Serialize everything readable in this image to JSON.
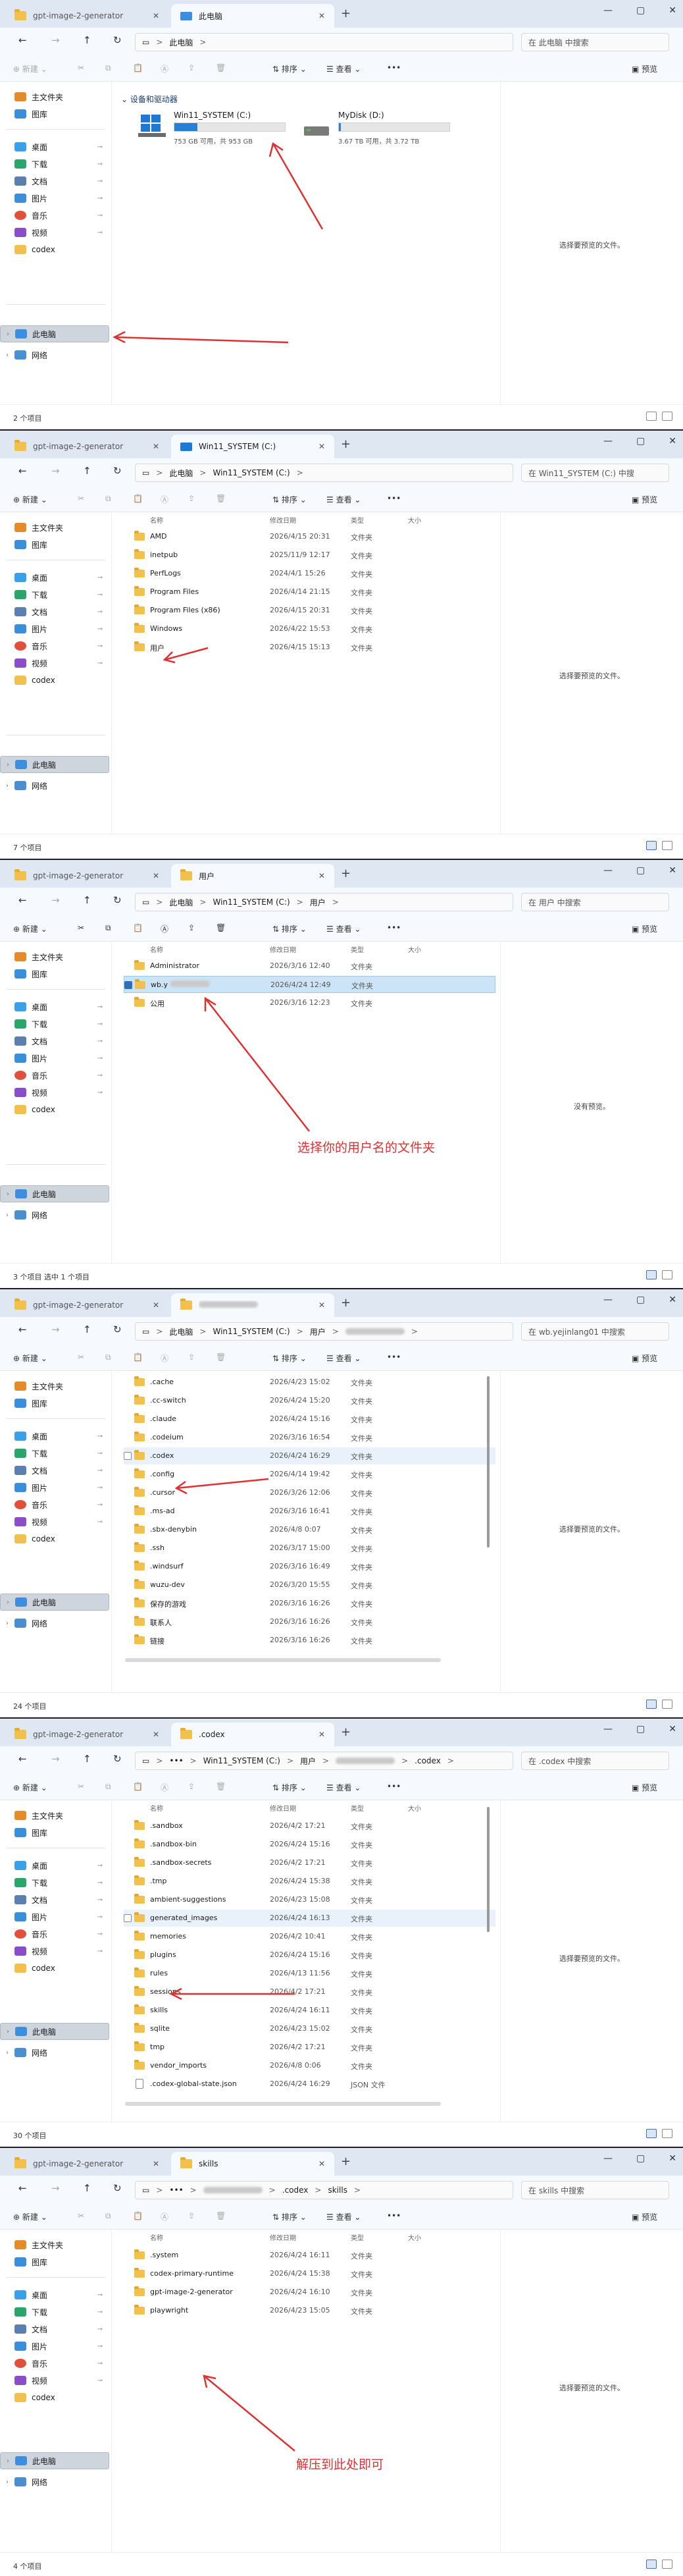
{
  "common": {
    "tab_first": "gpt-image-2-generator",
    "new_tab": "+",
    "win_min": "—",
    "win_max": "▢",
    "win_close": "✕",
    "tab_close": "✕",
    "back": "←",
    "forward": "→",
    "up": "↑",
    "refresh": "↻",
    "new_label": "新建",
    "new_arrow": "⌄",
    "sort_label": "排序",
    "view_label": "查看",
    "more": "•••",
    "details_label": "预览",
    "col_name": "名称",
    "col_date": "修改日期",
    "col_type": "类型",
    "col_size": "大小",
    "crumb_sep": ">",
    "ellipsis": "•••",
    "sidebar": {
      "home": "主文件夹",
      "gallery": "图库",
      "desktop": "桌面",
      "downloads": "下载",
      "documents": "文档",
      "pictures": "图片",
      "music": "音乐",
      "videos": "视频",
      "codex": "codex",
      "thispc": "此电脑",
      "network": "网络",
      "pin": "⊸",
      "chevron": "›"
    },
    "colors": {
      "accent": "#2680d8",
      "arrow": "#e03030",
      "folder": "#f2c04c"
    }
  },
  "screens": [
    {
      "active_tab": "此电脑",
      "crumbs": [
        "此电脑"
      ],
      "search": "在 此电脑 中搜索",
      "group_header": "设备和驱动器",
      "drives": [
        {
          "name": "Win11_SYSTEM (C:)",
          "size": "753 GB 可用，共 953 GB",
          "used": 0.21
        },
        {
          "name": "MyDisk (D:)",
          "size": "3.67 TB 可用，共 3.72 TB",
          "used": 0.02
        }
      ],
      "preview": "选择要预览的文件。",
      "status": "2 个项目",
      "rows": []
    },
    {
      "active_tab": "Win11_SYSTEM (C:)",
      "crumbs": [
        "此电脑",
        "Win11_SYSTEM (C:)"
      ],
      "search": "在 Win11_SYSTEM (C:) 中搜",
      "preview": "选择要预览的文件。",
      "status": "7 个项目",
      "rows": [
        {
          "name": "AMD",
          "date": "2026/4/15 20:31",
          "type": "文件夹"
        },
        {
          "name": "inetpub",
          "date": "2025/11/9 12:17",
          "type": "文件夹"
        },
        {
          "name": "PerfLogs",
          "date": "2024/4/1 15:26",
          "type": "文件夹"
        },
        {
          "name": "Program Files",
          "date": "2026/4/14 21:15",
          "type": "文件夹"
        },
        {
          "name": "Program Files (x86)",
          "date": "2026/4/15 20:31",
          "type": "文件夹"
        },
        {
          "name": "Windows",
          "date": "2026/4/22 15:53",
          "type": "文件夹"
        },
        {
          "name": "用户",
          "date": "2026/4/15 15:13",
          "type": "文件夹"
        }
      ]
    },
    {
      "active_tab": "用户",
      "crumbs": [
        "此电脑",
        "Win11_SYSTEM (C:)",
        "用户"
      ],
      "search": "在 用户 中搜索",
      "preview": "没有预览。",
      "status": "3 个项目    选中 1 个项目",
      "annotation": "选择你的用户名的文件夹",
      "rows": [
        {
          "name": "Administrator",
          "date": "2026/3/16 12:40",
          "type": "文件夹"
        },
        {
          "name": "wb.y",
          "date": "2026/4/24 12:49",
          "type": "文件夹",
          "selected": true
        },
        {
          "name": "公用",
          "date": "2026/3/16 12:23",
          "type": "文件夹"
        }
      ]
    },
    {
      "active_tab": "",
      "crumbs": [
        "此电脑",
        "Win11_SYSTEM (C:)",
        "用户",
        ""
      ],
      "search": "在 wb.yejinlang01 中搜索",
      "preview": "选择要预览的文件。",
      "status": "24 个项目",
      "rows": [
        {
          "name": ".cache",
          "date": "2026/4/23 15:02",
          "type": "文件夹"
        },
        {
          "name": ".cc-switch",
          "date": "2026/4/24 15:20",
          "type": "文件夹"
        },
        {
          "name": ".claude",
          "date": "2026/4/24 15:16",
          "type": "文件夹"
        },
        {
          "name": ".codeium",
          "date": "2026/3/16 16:54",
          "type": "文件夹"
        },
        {
          "name": ".codex",
          "date": "2026/4/24 16:29",
          "type": "文件夹",
          "hover": true
        },
        {
          "name": ".config",
          "date": "2026/4/14 19:42",
          "type": "文件夹"
        },
        {
          "name": ".cursor",
          "date": "2026/3/26 12:06",
          "type": "文件夹"
        },
        {
          "name": ".ms-ad",
          "date": "2026/3/16 16:41",
          "type": "文件夹"
        },
        {
          "name": ".sbx-denybin",
          "date": "2026/4/8 0:07",
          "type": "文件夹"
        },
        {
          "name": ".ssh",
          "date": "2026/3/17 15:00",
          "type": "文件夹"
        },
        {
          "name": ".windsurf",
          "date": "2026/3/16 16:49",
          "type": "文件夹"
        },
        {
          "name": "wuzu-dev",
          "date": "2026/3/20 15:55",
          "type": "文件夹"
        },
        {
          "name": "保存的游戏",
          "date": "2026/3/16 16:26",
          "type": "文件夹"
        },
        {
          "name": "联系人",
          "date": "2026/3/16 16:26",
          "type": "文件夹"
        },
        {
          "name": "链接",
          "date": "2026/3/16 16:26",
          "type": "文件夹"
        }
      ]
    },
    {
      "active_tab": ".codex",
      "crumbs": [
        "Win11_SYSTEM (C:)",
        "用户",
        "",
        ".codex"
      ],
      "search": "在 .codex 中搜索",
      "preview": "选择要预览的文件。",
      "status": "30 个项目",
      "rows": [
        {
          "name": ".sandbox",
          "date": "2026/4/2 17:21",
          "type": "文件夹"
        },
        {
          "name": ".sandbox-bin",
          "date": "2026/4/24 15:16",
          "type": "文件夹"
        },
        {
          "name": ".sandbox-secrets",
          "date": "2026/4/2 17:21",
          "type": "文件夹"
        },
        {
          "name": ".tmp",
          "date": "2026/4/24 15:38",
          "type": "文件夹"
        },
        {
          "name": "ambient-suggestions",
          "date": "2026/4/23 15:08",
          "type": "文件夹"
        },
        {
          "name": "generated_images",
          "date": "2026/4/24 16:13",
          "type": "文件夹",
          "hover": true
        },
        {
          "name": "memories",
          "date": "2026/4/2 10:41",
          "type": "文件夹"
        },
        {
          "name": "plugins",
          "date": "2026/4/24 15:16",
          "type": "文件夹"
        },
        {
          "name": "rules",
          "date": "2026/4/13 11:56",
          "type": "文件夹"
        },
        {
          "name": "sessions",
          "date": "2026/4/2 17:21",
          "type": "文件夹"
        },
        {
          "name": "skills",
          "date": "2026/4/24 16:11",
          "type": "文件夹"
        },
        {
          "name": "sqlite",
          "date": "2026/4/23 15:02",
          "type": "文件夹"
        },
        {
          "name": "tmp",
          "date": "2026/4/2 17:21",
          "type": "文件夹"
        },
        {
          "name": "vendor_imports",
          "date": "2026/4/8 0:06",
          "type": "文件夹"
        },
        {
          "name": ".codex-global-state.json",
          "date": "2026/4/24 16:29",
          "type": "JSON 文件",
          "file": true
        }
      ]
    },
    {
      "active_tab": "skills",
      "crumbs": [
        "",
        ".codex",
        "skills"
      ],
      "search": "在 skills 中搜索",
      "preview": "选择要预览的文件。",
      "status": "4 个项目",
      "annotation": "解压到此处即可",
      "rows": [
        {
          "name": ".system",
          "date": "2026/4/24 16:11",
          "type": "文件夹"
        },
        {
          "name": "codex-primary-runtime",
          "date": "2026/4/24 15:38",
          "type": "文件夹"
        },
        {
          "name": "gpt-image-2-generator",
          "date": "2026/4/24 16:10",
          "type": "文件夹"
        },
        {
          "name": "playwright",
          "date": "2026/4/23 15:05",
          "type": "文件夹"
        }
      ]
    }
  ]
}
